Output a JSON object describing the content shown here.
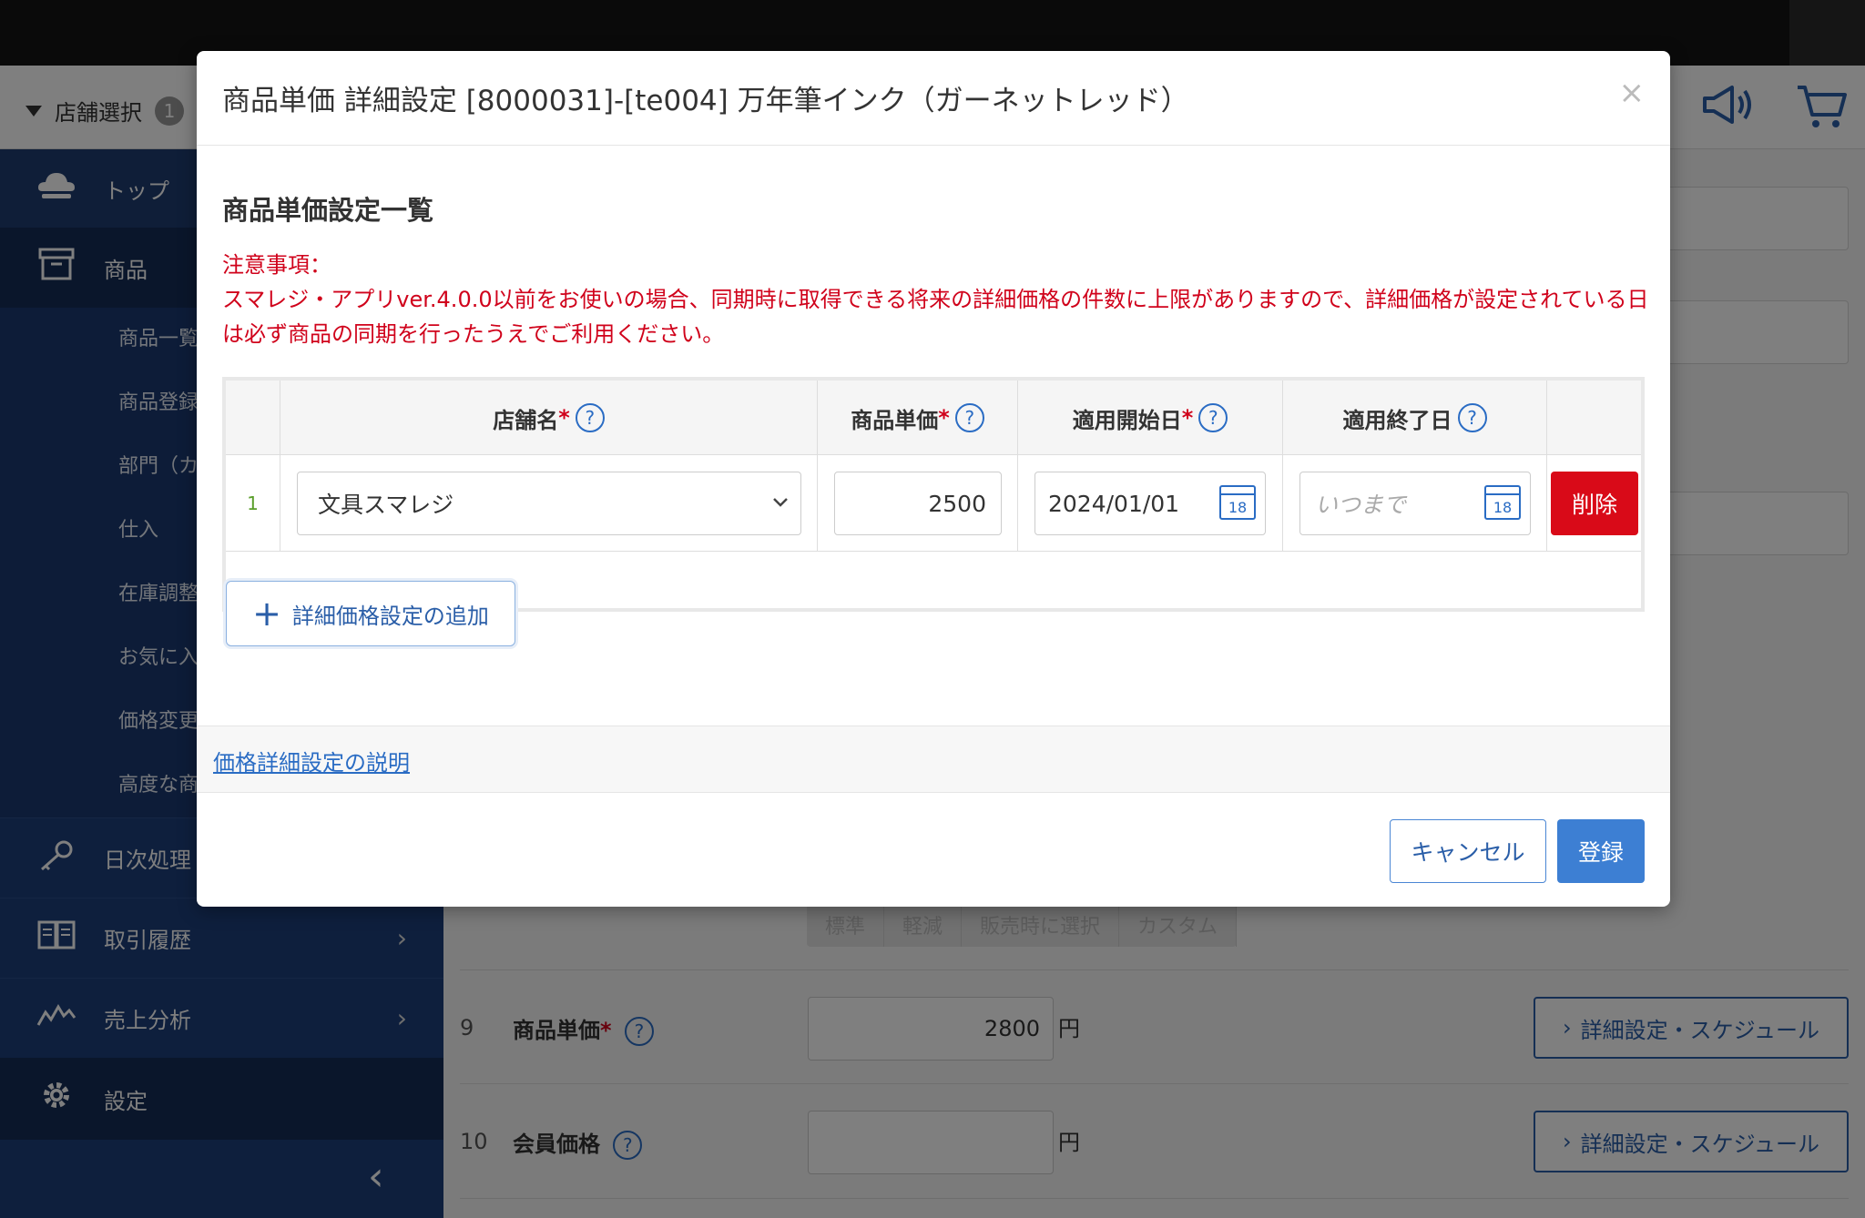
{
  "header": {
    "store_select_label": "店舗選択",
    "store_count": "1",
    "megaphone_icon": "megaphone-icon",
    "cart_icon": "cart-icon"
  },
  "sidebar": {
    "top_label": "トップ",
    "product_label": "商品",
    "product_sub": [
      "商品一覧",
      "商品登録",
      "部門（カ",
      "仕入",
      "在庫調整",
      "お気に入",
      "価格変更",
      "高度な商"
    ],
    "daily_label": "日次処理",
    "history_label": "取引履歴",
    "sales_label": "売上分析",
    "settings_label": "設定"
  },
  "background_form": {
    "tax_segments": [
      "標準",
      "軽減",
      "販売時に選択",
      "カスタム"
    ],
    "row9": {
      "num": "9",
      "label": "商品単価",
      "value": "2800",
      "unit": "円",
      "detail_label": "詳細設定・スケジュール"
    },
    "row10": {
      "num": "10",
      "label": "会員価格",
      "value": "",
      "unit": "円",
      "detail_label": "詳細設定・スケジュール"
    }
  },
  "modal": {
    "title": "商品単価 詳細設定 [8000031]-[te004] 万年筆インク（ガーネットレッド）",
    "close": "×",
    "section_title": "商品単価設定一覧",
    "notice_heading": "注意事項：",
    "notice_body": "スマレジ・アプリver.4.0.0以前をお使いの場合、同期時に取得できる将来の詳細価格の件数に上限がありますので、詳細価格が設定されている日は必ず商品の同期を行ったうえでご利用ください。",
    "table": {
      "headers": {
        "store": "店舗名",
        "price": "商品単価",
        "start": "適用開始日",
        "end": "適用終了日"
      },
      "rows": [
        {
          "num": "1",
          "store": "文具スマレジ",
          "price": "2500",
          "start": "2024/01/01",
          "end_placeholder": "いつまで",
          "delete": "削除"
        }
      ],
      "calendar_day": "18"
    },
    "add_button": "詳細価格設定の追加",
    "info_link": "価格詳細設定の説明",
    "cancel": "キャンセル",
    "submit": "登録"
  }
}
